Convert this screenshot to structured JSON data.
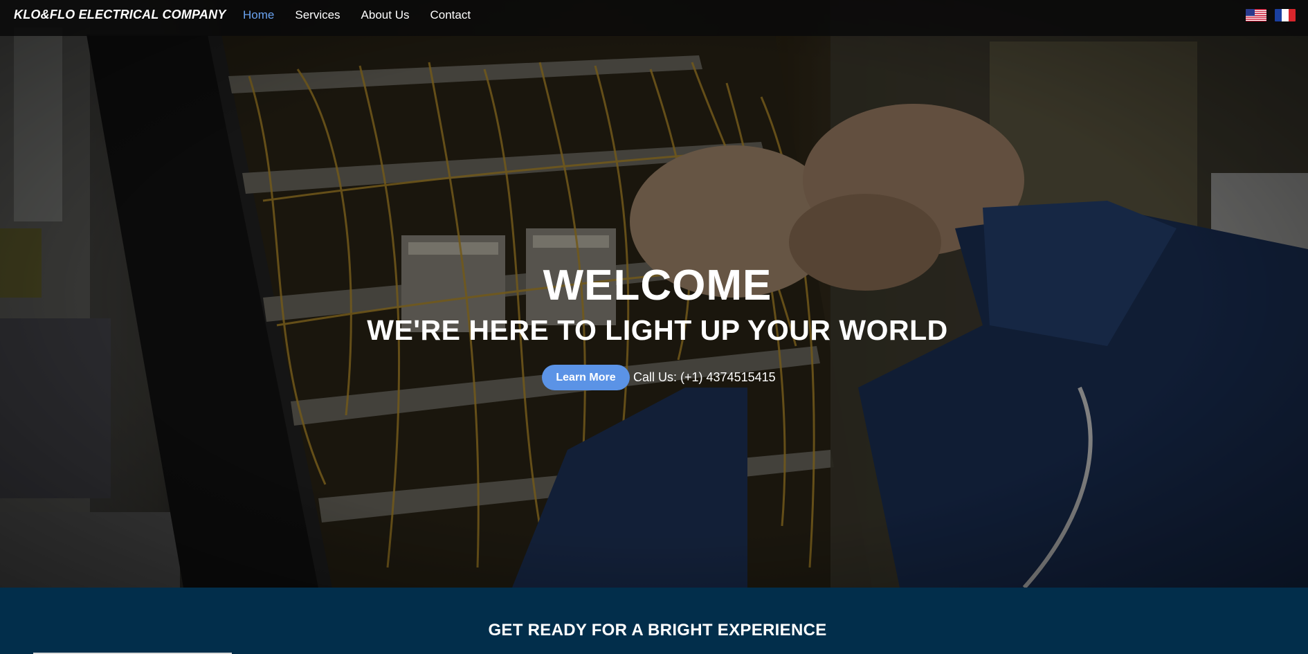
{
  "navbar": {
    "brand": "KLO&FLO ELECTRICAL COMPANY",
    "links": [
      {
        "label": "Home",
        "active": true
      },
      {
        "label": "Services",
        "active": false
      },
      {
        "label": "About Us",
        "active": false
      },
      {
        "label": "Contact",
        "active": false
      }
    ],
    "languages": [
      {
        "icon": "us-flag-icon"
      },
      {
        "icon": "france-flag-icon"
      }
    ],
    "active_color": "#6aa3f0"
  },
  "hero": {
    "title": "WELCOME",
    "subtitle": "WE'RE HERE TO LIGHT UP YOUR WORLD",
    "cta_label": "Learn More",
    "call_text": "Call Us: (+1) 4374515415",
    "cta_color": "#5b93e6"
  },
  "section": {
    "title": "GET READY FOR A BRIGHT EXPERIENCE",
    "background": "#022e4b"
  }
}
